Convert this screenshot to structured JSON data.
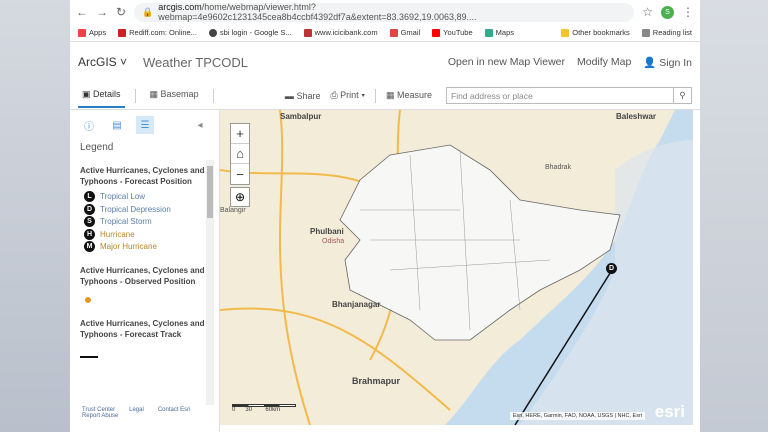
{
  "browser": {
    "url_host": "arcgis.com",
    "url_rest": "/home/webmap/viewer.html?webmap=4e9602c1231345cea8b4ccbf4392df7a&extent=83.3692,19.0063,89....",
    "profile_initial": "S",
    "bookmarks": [
      "Apps",
      "Rediff.com: Online...",
      "sbi login - Google S...",
      "www.icicibank.com",
      "Gmail",
      "YouTube",
      "Maps"
    ],
    "other_bookmarks": "Other bookmarks",
    "reading_list": "Reading list"
  },
  "header": {
    "logo": "ArcGIS",
    "title": "Weather TPCODL",
    "links": [
      "Open in new Map Viewer",
      "Modify Map",
      "Sign In"
    ]
  },
  "toolbar": {
    "details": "Details",
    "basemap": "Basemap",
    "share": "Share",
    "print": "Print",
    "measure": "Measure",
    "search_placeholder": "Find address or place"
  },
  "sidebar": {
    "legend_title": "Legend",
    "sections": [
      {
        "title": "Active Hurricanes, Cyclones and Typhoons - Forecast Position",
        "items": [
          {
            "symbol": "L",
            "label": "Tropical Low"
          },
          {
            "symbol": "D",
            "label": "Tropical Depression"
          },
          {
            "symbol": "S",
            "label": "Tropical Storm"
          },
          {
            "symbol": "H",
            "label": "Hurricane"
          },
          {
            "symbol": "M",
            "label": "Major Hurricane"
          }
        ]
      },
      {
        "title": "Active Hurricanes, Cyclones and Typhoons - Observed Position"
      },
      {
        "title": "Active Hurricanes, Cyclones and Typhoons - Forecast Track"
      }
    ],
    "footer": [
      "Trust Center",
      "Legal",
      "Contact Esri",
      "Report Abuse"
    ]
  },
  "map": {
    "places": [
      "Sambalpur",
      "Baleshwar",
      "Bhadrak",
      "Phulbani",
      "Odisha",
      "Balangir",
      "Bhanjanagar",
      "Brahmapur"
    ],
    "scale": [
      "0",
      "30",
      "60km"
    ],
    "attribution": "Esri, HERE, Garmin, FAO, NOAA, USGS | NHC, Esri",
    "esri_logo": "esri",
    "storm_symbol": "D",
    "colors": {
      "land": "#f3ecd9",
      "sea": "#c5dcef",
      "roads": "#f3b94a",
      "track": "#111111",
      "observed": "#e8961c"
    }
  }
}
